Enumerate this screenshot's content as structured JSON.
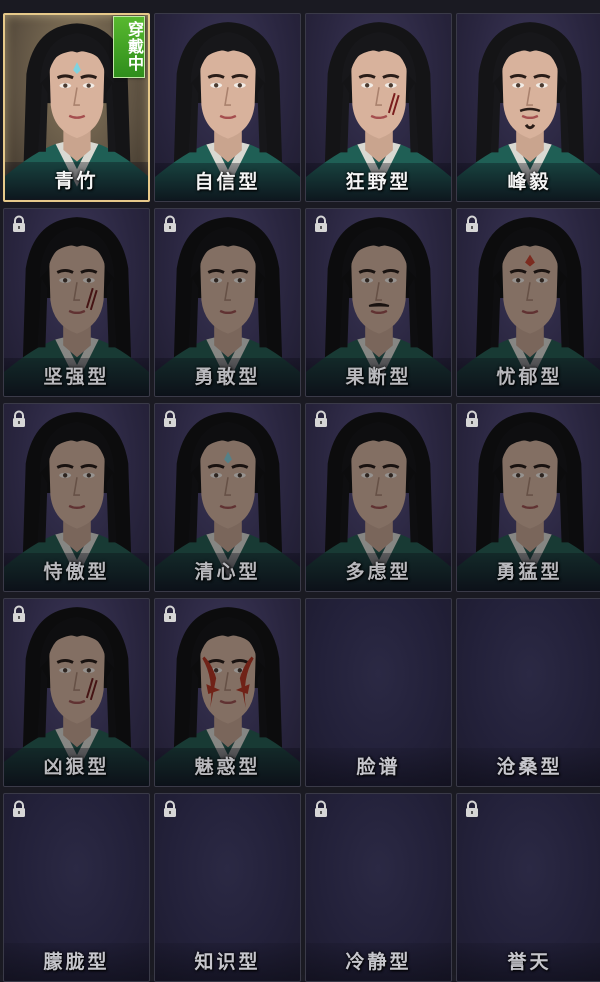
{
  "colors": {
    "selected_border": "#e6c98a",
    "badge_green": "#3fa622",
    "tile_bg": "#2a2640",
    "label_text": "#f4f4f4"
  },
  "badge_text": "穿戴中",
  "tiles": [
    {
      "label": "青竹",
      "state": "selected",
      "portrait": "face-blue-mark"
    },
    {
      "label": "自信型",
      "state": "unlocked",
      "portrait": "face-plain"
    },
    {
      "label": "狂野型",
      "state": "unlocked",
      "portrait": "face-scar"
    },
    {
      "label": "峰毅",
      "state": "unlocked",
      "portrait": "face-beard"
    },
    {
      "label": "坚强型",
      "state": "locked",
      "portrait": "face-scar"
    },
    {
      "label": "勇敢型",
      "state": "locked",
      "portrait": "face-plain"
    },
    {
      "label": "果断型",
      "state": "locked",
      "portrait": "face-mustache"
    },
    {
      "label": "忧郁型",
      "state": "locked",
      "portrait": "face-red-mark"
    },
    {
      "label": "恃傲型",
      "state": "locked",
      "portrait": "face-plain"
    },
    {
      "label": "清心型",
      "state": "locked",
      "portrait": "face-blue-mark"
    },
    {
      "label": "多虑型",
      "state": "locked",
      "portrait": "face-plain"
    },
    {
      "label": "勇猛型",
      "state": "locked",
      "portrait": "face-plain"
    },
    {
      "label": "凶狠型",
      "state": "locked",
      "portrait": "face-scar"
    },
    {
      "label": "魅惑型",
      "state": "locked",
      "portrait": "face-red-paint"
    },
    {
      "label": "脸谱",
      "state": "empty-unlocked",
      "portrait": "none"
    },
    {
      "label": "沧桑型",
      "state": "empty-unlocked",
      "portrait": "none"
    },
    {
      "label": "朦胧型",
      "state": "empty-locked",
      "portrait": "none"
    },
    {
      "label": "知识型",
      "state": "empty-locked",
      "portrait": "none"
    },
    {
      "label": "冷静型",
      "state": "empty-locked",
      "portrait": "none"
    },
    {
      "label": "誉天",
      "state": "empty-locked",
      "portrait": "none"
    }
  ]
}
